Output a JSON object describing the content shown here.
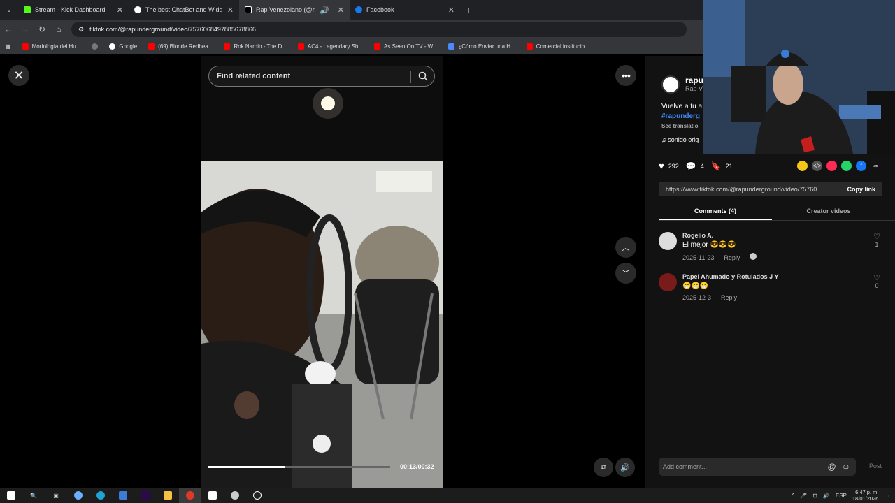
{
  "browser": {
    "tabs": [
      {
        "title": "Stream - Kick Dashboard",
        "favicon_color": "#53fc18",
        "active": false
      },
      {
        "title": "The best ChatBot and Widgets",
        "favicon_color": "#ffffff",
        "active": false
      },
      {
        "title": "Rap Venezolano (@rapund",
        "favicon_color": "#111111",
        "active": true
      },
      {
        "title": "Facebook",
        "favicon_color": "#1877f2",
        "active": false
      }
    ],
    "url": "tiktok.com/@rapunderground/video/7576068497885678866",
    "bookmarks": [
      {
        "label": "Morfología del Hu...",
        "color": "#ff0000"
      },
      {
        "label": "",
        "color": "#777777"
      },
      {
        "label": "Google",
        "color": "#ffffff"
      },
      {
        "label": "(69) Blonde Redhea...",
        "color": "#ff0000"
      },
      {
        "label": "Rok Nardin - The D...",
        "color": "#ff0000"
      },
      {
        "label": "AC4 - Legendary Sh...",
        "color": "#ff0000"
      },
      {
        "label": "As Seen On TV - W...",
        "color": "#ff0000"
      },
      {
        "label": "¿Cómo Enviar una H...",
        "color": "#4a8cff"
      },
      {
        "label": "Comercial institucio...",
        "color": "#ff0000"
      }
    ]
  },
  "player": {
    "search_placeholder": "Find related content",
    "timecode": "00:13/00:32",
    "progress": 0.42
  },
  "panel": {
    "author": {
      "name": "rapu",
      "subtitle": "Rap V"
    },
    "description": {
      "line1": "Vuelve a tu a",
      "hashtag": "#rapunderg",
      "see_translation": "See translatio",
      "sound": "sonido orig"
    },
    "stats": {
      "likes": "292",
      "comments": "4",
      "saves": "21"
    },
    "share_colors": [
      "#f5c518",
      "#555555",
      "#fe2c55",
      "#25d366",
      "#1877f2",
      "#ffffff"
    ],
    "link": "https://www.tiktok.com/@rapunderground/video/75760...",
    "copy_link": "Copy link",
    "tabs": [
      "Comments (4)",
      "Creator videos"
    ],
    "comments": [
      {
        "name": "Rogelio A.",
        "text": "El mejor 😎😎😎",
        "date": "2025-11-23",
        "reply": "Reply",
        "likes": "1"
      },
      {
        "name": "Papel Ahumado y Rotulados J Y",
        "text": "😁😁😁",
        "date": "2025-12-3",
        "reply": "Reply",
        "likes": "0"
      }
    ],
    "add_comment_placeholder": "Add comment...",
    "post": "Post"
  },
  "taskbar": {
    "lang": "ESP",
    "time": "6:47 p. m.",
    "date": "18/01/2026"
  }
}
